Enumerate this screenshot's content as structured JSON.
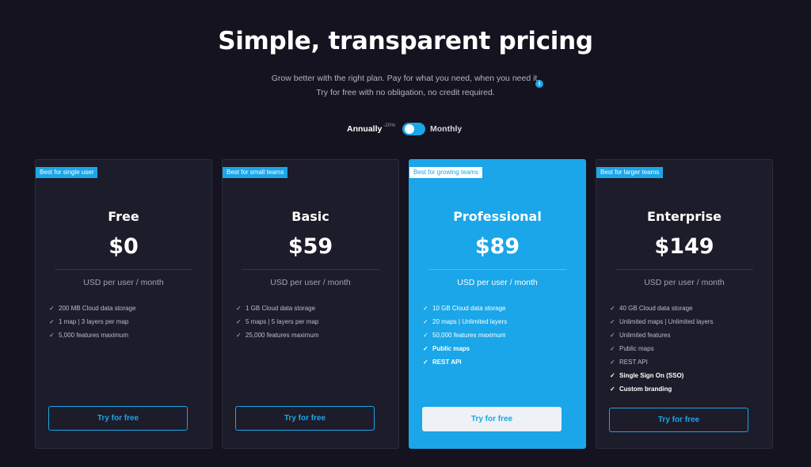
{
  "header": {
    "title": "Simple, transparent pricing",
    "subtitle_line1": "Grow better with the right plan. Pay for what you need, when you need it.",
    "subtitle_line2": "Try for free with no obligation, no credit required.",
    "info_icon": "info-icon"
  },
  "billing": {
    "annually_label": "Annually",
    "discount_label": "-20%",
    "monthly_label": "Monthly",
    "selected": "Monthly"
  },
  "colors": {
    "background": "#14131f",
    "card": "#1d1c2a",
    "accent": "#1aa6e8"
  },
  "plans": [
    {
      "badge": "Best for single user",
      "name": "Free",
      "price": "$0",
      "unit": "USD per user / month",
      "features": [
        {
          "text": "200 MB Cloud data storage",
          "bold": false
        },
        {
          "text": "1 map | 3 layers per map",
          "bold": false
        },
        {
          "text": "5,000 features maximum",
          "bold": false
        }
      ],
      "cta": "Try for free"
    },
    {
      "badge": "Best for small teams",
      "name": "Basic",
      "price": "$59",
      "unit": "USD per user / month",
      "features": [
        {
          "text": "1 GB Cloud data storage",
          "bold": false
        },
        {
          "text": "5 maps | 5 layers per map",
          "bold": false
        },
        {
          "text": "25,000 features maximum",
          "bold": false
        }
      ],
      "cta": "Try for free"
    },
    {
      "badge": "Best for growing teams",
      "name": "Professional",
      "price": "$89",
      "unit": "USD per user / month",
      "features": [
        {
          "text": "10 GB Cloud data storage",
          "bold": false
        },
        {
          "text": "20 maps | Unlimited layers",
          "bold": false
        },
        {
          "text": "50,000 features maximum",
          "bold": false
        },
        {
          "text": "Public maps",
          "bold": true
        },
        {
          "text": "REST API",
          "bold": true
        }
      ],
      "cta": "Try for free"
    },
    {
      "badge": "Best for larger teams",
      "name": "Enterprise",
      "price": "$149",
      "unit": "USD per user / month",
      "features": [
        {
          "text": "40 GB Cloud data storage",
          "bold": false
        },
        {
          "text": "Unlimited maps | Unlimited layers",
          "bold": false
        },
        {
          "text": "Unlimited features",
          "bold": false
        },
        {
          "text": "Public maps",
          "bold": false
        },
        {
          "text": "REST API",
          "bold": false
        },
        {
          "text": "Single Sign On (SSO)",
          "bold": true
        },
        {
          "text": "Custom branding",
          "bold": true
        }
      ],
      "cta": "Try for free"
    }
  ]
}
